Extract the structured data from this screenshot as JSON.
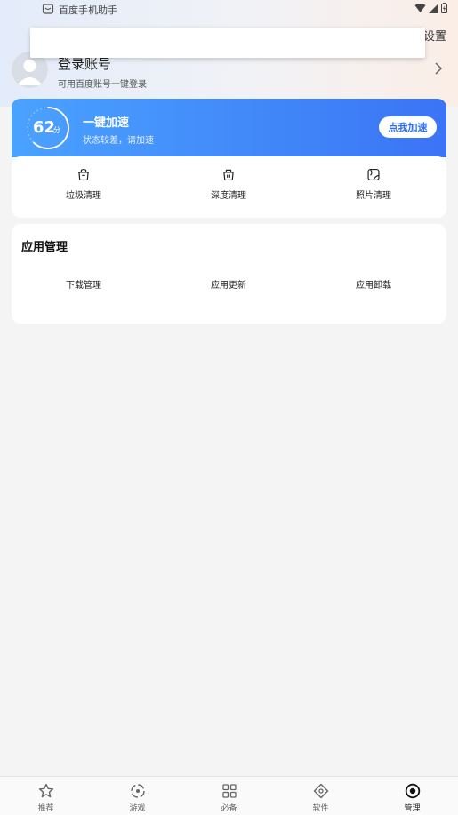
{
  "statusbar": {
    "app_name": "百度手机助手"
  },
  "header": {
    "settings_label": "设置"
  },
  "account": {
    "title": "登录账号",
    "subtitle": "可用百度账号一键登录"
  },
  "speed": {
    "score": "62",
    "unit": "分",
    "title": "一键加速",
    "subtitle": "状态较差，请加速",
    "button_label": "点我加速",
    "score_fraction": 0.62
  },
  "clean": {
    "items": [
      {
        "label": "垃圾清理",
        "icon": "trash-bin-icon"
      },
      {
        "label": "深度清理",
        "icon": "deep-clean-icon"
      },
      {
        "label": "照片清理",
        "icon": "photo-clean-icon"
      }
    ]
  },
  "app_manage": {
    "title": "应用管理",
    "items": [
      {
        "label": "下载管理",
        "icon": "download-icon",
        "color": "#f8b845"
      },
      {
        "label": "应用更新",
        "icon": "update-icon",
        "color": "#4d92f7"
      },
      {
        "label": "应用卸载",
        "icon": "uninstall-icon",
        "color": "#f2676a"
      }
    ]
  },
  "nav": {
    "items": [
      {
        "label": "推荐",
        "icon": "star-icon"
      },
      {
        "label": "游戏",
        "icon": "gamepad-icon"
      },
      {
        "label": "必备",
        "icon": "grid-icon"
      },
      {
        "label": "软件",
        "icon": "diamond-icon"
      },
      {
        "label": "管理",
        "icon": "manage-icon"
      }
    ],
    "active_index": 4
  },
  "colors": {
    "accent": "#3b74f5",
    "accent_light": "#4aa2ff",
    "background": "#f4f4f4"
  }
}
